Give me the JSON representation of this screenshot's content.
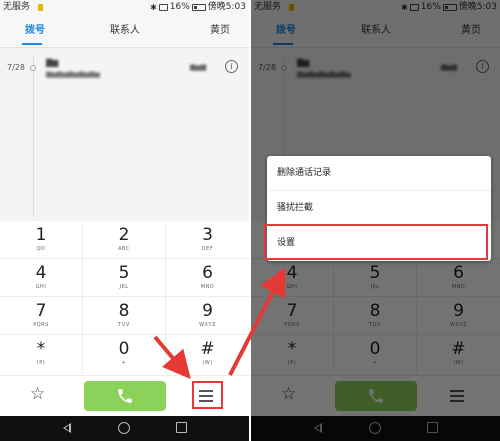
{
  "status_bar": {
    "carrier": "无服务",
    "battery": "16%",
    "time": "傍晚5:03"
  },
  "tabs": [
    {
      "label": "拨号",
      "active": true
    },
    {
      "label": "联系人",
      "active": false
    },
    {
      "label": "黄页",
      "active": false
    }
  ],
  "call_log": {
    "date": "7/28",
    "info_icon": "i"
  },
  "keypad": [
    {
      "num": "1",
      "sub": "QD"
    },
    {
      "num": "2",
      "sub": "ABC"
    },
    {
      "num": "3",
      "sub": "DEF"
    },
    {
      "num": "4",
      "sub": "GHI"
    },
    {
      "num": "5",
      "sub": "JKL"
    },
    {
      "num": "6",
      "sub": "MNO"
    },
    {
      "num": "7",
      "sub": "PQRS"
    },
    {
      "num": "8",
      "sub": "TUV"
    },
    {
      "num": "9",
      "sub": "WXYZ"
    },
    {
      "num": "*",
      "sub": "(P)"
    },
    {
      "num": "0",
      "sub": "+"
    },
    {
      "num": "#",
      "sub": "(W)"
    }
  ],
  "action_bar": {
    "favorites_icon": "star-icon",
    "call_icon": "phone-icon",
    "menu_icon": "menu-icon"
  },
  "popup_menu": {
    "items": [
      "删除通话记录",
      "骚扰拦截",
      "设置"
    ],
    "highlighted_index": 2
  },
  "colors": {
    "accent_blue": "#1e88e5",
    "call_green": "#8cd15a",
    "highlight_red": "#e53935"
  }
}
